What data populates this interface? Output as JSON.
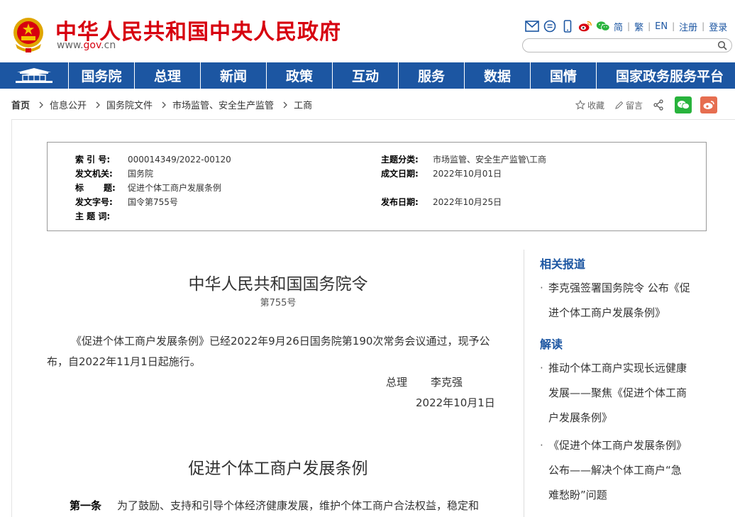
{
  "header": {
    "title": "中华人民共和国中央人民政府",
    "url_prefix": "www.",
    "url_red": "gov",
    "url_suffix": ".cn",
    "tools": {
      "simplified": "简",
      "traditional": "繁",
      "english": "EN",
      "register": "注册",
      "login": "登录",
      "sep": "|"
    },
    "search_placeholder": ""
  },
  "nav": {
    "items": [
      "国务院",
      "总理",
      "新闻",
      "政策",
      "互动",
      "服务",
      "数据",
      "国情",
      "国家政务服务平台"
    ]
  },
  "breadcrumb": {
    "items": [
      "首页",
      "信息公开",
      "国务院文件",
      "市场监管、安全生产监管",
      "工商"
    ]
  },
  "actions": {
    "favorite": "收藏",
    "comment": "留言"
  },
  "meta": {
    "index_label": "索 引 号:",
    "index_value": "000014349/2022-00120",
    "category_label": "主题分类:",
    "category_value": "市场监管、安全生产监管\\工商",
    "issuer_label": "发文机关:",
    "issuer_value": "国务院",
    "date_written_label": "成文日期:",
    "date_written_value": "2022年10月01日",
    "title_label_a": "标",
    "title_label_b": "题:",
    "title_value": "促进个体工商户发展条例",
    "doc_no_label": "发文字号:",
    "doc_no_value": "国令第755号",
    "pub_date_label": "发布日期:",
    "pub_date_value": "2022年10月25日",
    "keywords_label": "主 题 词:",
    "keywords_value": ""
  },
  "article": {
    "order_title": "中华人民共和国国务院令",
    "order_no": "第755号",
    "para1_line1": "《促进个体工商户发展条例》已经2022年9月26日国务院第190次常务会议通过，现予公",
    "para1_line2": "布，自2022年11月1日起施行。",
    "signer_title": "总理",
    "signer_name": "李克强",
    "sign_date": "2022年10月1日",
    "reg_title": "促进个体工商户发展条例",
    "art1_label": "第一条",
    "art1_text": "为了鼓励、支持和引导个体经济健康发展，维护个体工商户合法权益，稳定和"
  },
  "sidebar": {
    "related_title": "相关报道",
    "related_items": [
      [
        "李克强签署国务院令 公布《促",
        "进个体工商户发展条例》"
      ]
    ],
    "interpret_title": "解读",
    "interpret_items": [
      [
        "推动个体工商户实现长远健康",
        "发展——聚焦《促进个体工商",
        "户发展条例》"
      ],
      [
        "《促进个体工商户发展条例》",
        "公布——解决个体工商户“急",
        "难愁盼”问题"
      ]
    ]
  },
  "colors": {
    "brand_red": "#d7000f",
    "nav_blue": "#1c56a2",
    "wechat_green": "#28b33c",
    "weibo_orange": "#e66e50"
  }
}
